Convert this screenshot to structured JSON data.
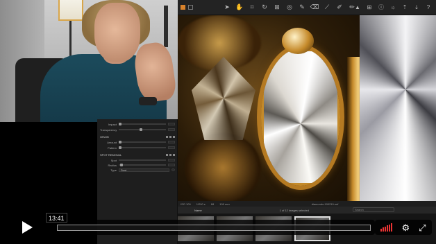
{
  "player": {
    "current_time": "13:41",
    "progress": 0.0,
    "volume_level": 1.0
  },
  "app": {
    "toolbar": {
      "tools": [
        "cursor-icon",
        "pan-icon",
        "crop-icon",
        "rotate-icon",
        "keystone-icon",
        "spot-icon",
        "layer-brush-icon",
        "eraser-icon",
        "gradient-icon",
        "picker-icon",
        "annotate-icon"
      ],
      "right_tools": [
        "warning-icon",
        "grid-icon",
        "info-icon",
        "adjust-icon",
        "copy-icon",
        "paste-icon",
        "help-icon"
      ]
    },
    "status": {
      "iso": "ISO 100",
      "shutter": "1/200 s",
      "aperture": "f/8",
      "focal": "100 mm",
      "filename": "diamonds-190219.nef"
    },
    "filter_bar": {
      "sort_label": "Name",
      "count_text": "1 of 12 images selected",
      "search_placeholder": "Search"
    },
    "tool_panel": {
      "rows_top": [
        {
          "label": "Impact"
        },
        {
          "label": "Transparency"
        }
      ],
      "section_grain": "GRAIN",
      "rows_grain": [
        {
          "label": "Amount"
        },
        {
          "label": "Pattern"
        }
      ],
      "section_spot": "SPOT REMOVAL",
      "rows_spot": [
        {
          "label": "Spot"
        },
        {
          "label": "Radius"
        },
        {
          "label": "Type"
        }
      ],
      "type_value": "Dust"
    }
  },
  "colors": {
    "accent": "#d9822b",
    "volume": "#e33333"
  }
}
